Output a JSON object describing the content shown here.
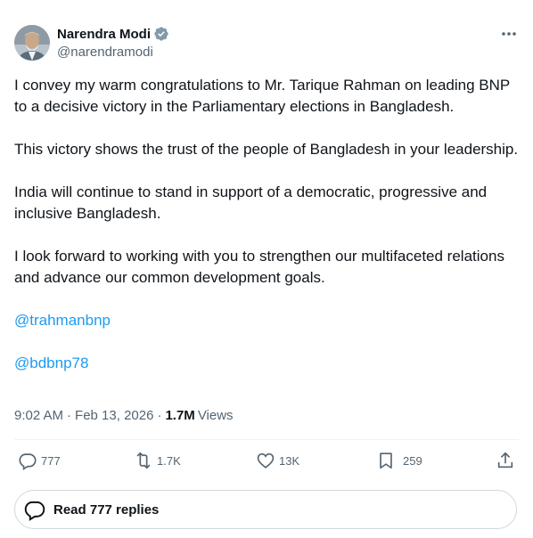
{
  "author": {
    "name": "Narendra Modi",
    "handle": "@narendramodi",
    "verified": true,
    "avatar_icon": "avatar-portrait"
  },
  "tweet": {
    "paragraphs": [
      "I convey my warm congratulations to Mr. Tarique Rahman on leading BNP to a decisive victory in the Parliamentary elections in Bangladesh.",
      "This victory shows the trust of the people of Bangladesh in your leadership.",
      "India will continue to stand in support of a democratic, progressive and inclusive Bangladesh.",
      "I look forward to working with you to strengthen our multifaceted relations and advance our common development goals."
    ],
    "mentions": [
      "@trahmanbnp",
      "@bdbnp78"
    ]
  },
  "meta": {
    "time": "9:02 AM",
    "separator": "·",
    "date": "Feb 13, 2026",
    "views_count": "1.7M",
    "views_label": "Views"
  },
  "actions": {
    "replies": "777",
    "reposts": "1.7K",
    "likes": "13K",
    "bookmarks": "259"
  },
  "read_replies_label": "Read 777 replies",
  "colors": {
    "link": "#1d9bf0",
    "secondary_text": "#536471",
    "primary_text": "#0f1419",
    "verified_badge": "#829aab",
    "border": "#cfd9de"
  }
}
